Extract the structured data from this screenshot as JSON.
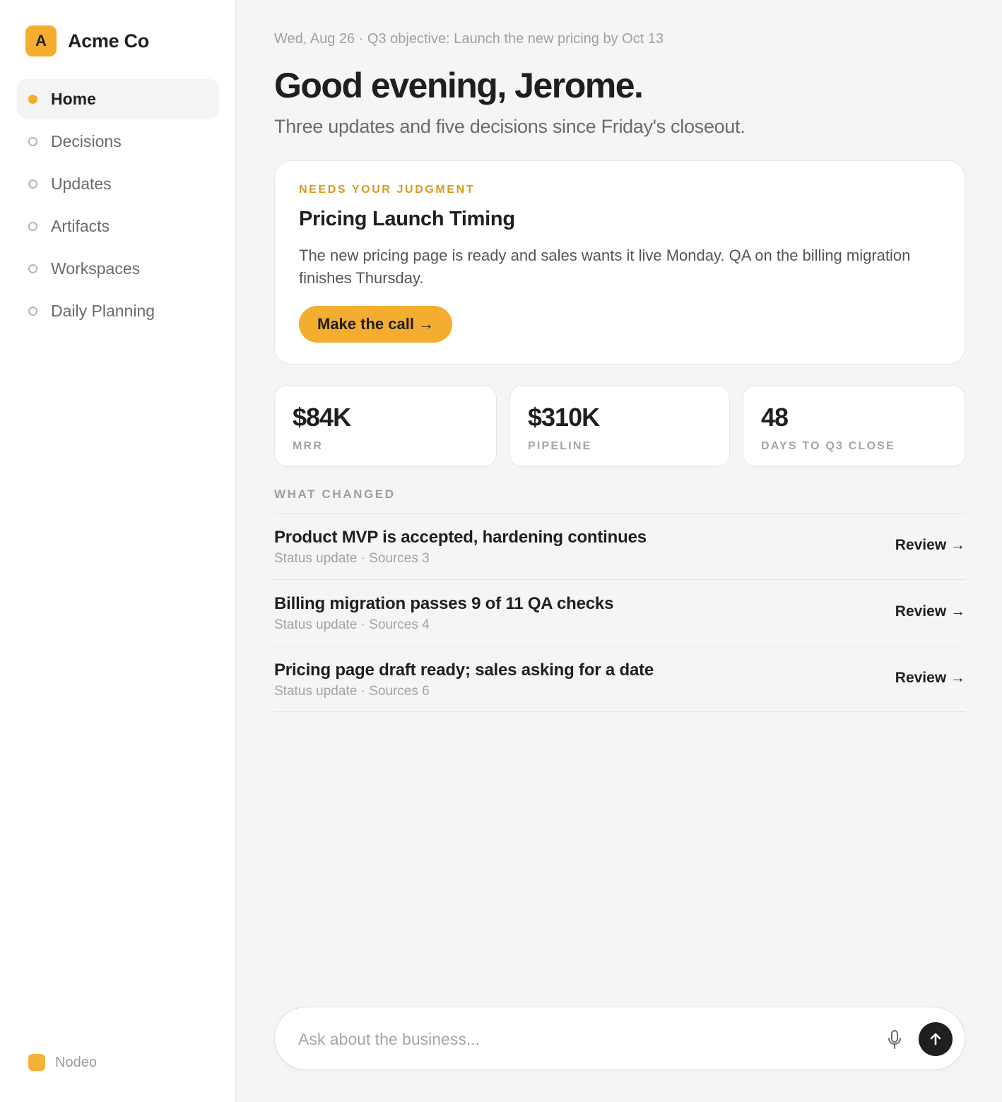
{
  "sidebar": {
    "brand_initial": "A",
    "brand_name": "Acme Co",
    "items": [
      {
        "label": "Home",
        "active": true
      },
      {
        "label": "Decisions",
        "active": false
      },
      {
        "label": "Updates",
        "active": false
      },
      {
        "label": "Artifacts",
        "active": false
      },
      {
        "label": "Workspaces",
        "active": false
      },
      {
        "label": "Daily Planning",
        "active": false
      }
    ],
    "footer_name": "Nodeo"
  },
  "header": {
    "meta": "Wed, Aug 26 · Q3 objective: Launch the new pricing by Oct 13",
    "greeting": "Good evening, Jerome.",
    "subtitle": "Three updates and five decisions since Friday's closeout."
  },
  "judgment": {
    "eyebrow": "NEEDS YOUR JUDGMENT",
    "title": "Pricing Launch Timing",
    "body": "The new pricing page is ready and sales wants it live Monday. QA on the billing migration finishes Thursday.",
    "cta_label": "Make the call →"
  },
  "stats": [
    {
      "value": "$84K",
      "label": "MRR"
    },
    {
      "value": "$310K",
      "label": "PIPELINE"
    },
    {
      "value": "48",
      "label": "DAYS TO Q3 CLOSE"
    }
  ],
  "changes": {
    "section_label": "WHAT CHANGED",
    "items": [
      {
        "title": "Product MVP is accepted, hardening continues",
        "meta": "Status update · Sources 3",
        "action": "Review →"
      },
      {
        "title": "Billing migration passes 9 of 11 QA checks",
        "meta": "Status update · Sources 4",
        "action": "Review →"
      },
      {
        "title": "Pricing page draft ready; sales asking for a date",
        "meta": "Status update · Sources 6",
        "action": "Review →"
      }
    ]
  },
  "composer": {
    "placeholder": "Ask about the business..."
  },
  "colors": {
    "accent": "#f5ad2f",
    "eyebrow": "#d89a1c",
    "text": "#1f1f1f",
    "muted": "#a0a0a0",
    "background": "#f5f5f5"
  },
  "icons": {
    "mic": "microphone-icon",
    "send": "arrow-up-icon"
  }
}
